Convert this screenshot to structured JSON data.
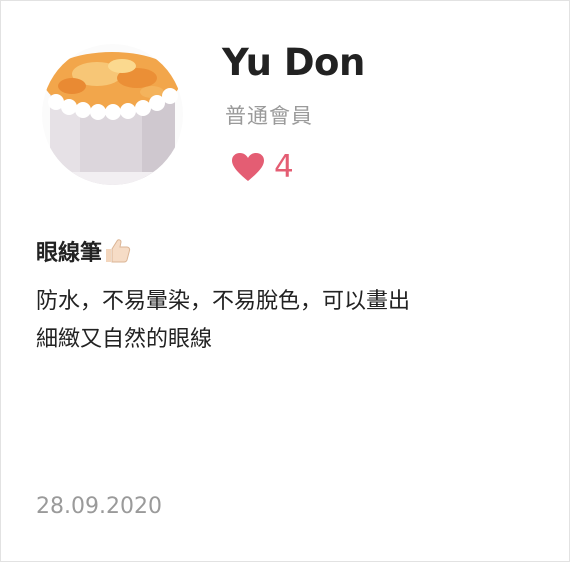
{
  "profile": {
    "name": "Yu Don",
    "member_level": "普通會員",
    "like_count": "4",
    "avatar_icon": "cake-photo-avatar",
    "like_icon": "heart-icon",
    "like_color": "#e45d73"
  },
  "review": {
    "title": "眼線筆",
    "title_emoji": "thumbs-up-icon",
    "body_lines": [
      "防水，不易暈染，不易脫色，可以畫出",
      "細緻又自然的眼線"
    ],
    "date": "28.09.2020"
  }
}
